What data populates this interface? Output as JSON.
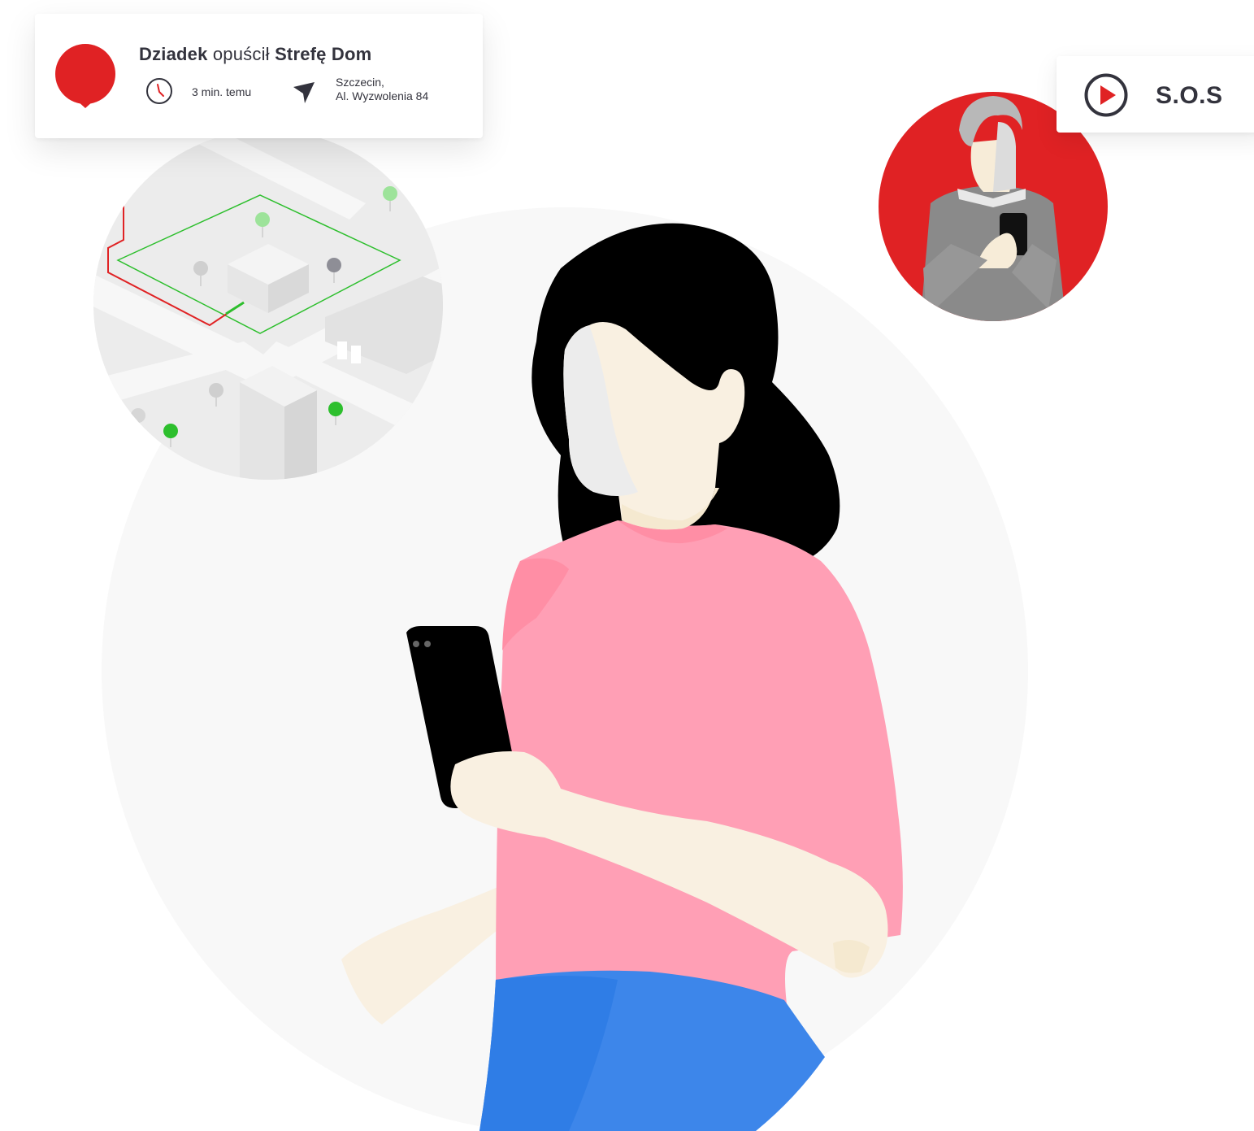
{
  "notification": {
    "subject": "Dziadek",
    "action": "opuścił",
    "zone": "Strefę Dom",
    "time_ago": "3 min. temu",
    "address_line1": "Szczecin,",
    "address_line2": "Al. Wyzwolenia 84",
    "pin_icon": "location-pin-icon",
    "time_icon": "clock-icon",
    "location_icon": "navigation-arrow-icon"
  },
  "sos": {
    "label": "S.O.S",
    "icon": "play-icon"
  },
  "colors": {
    "brand_red": "#e02224",
    "text_dark": "#33333d",
    "zone_green": "#2dbf2d",
    "shirt_pink": "#ff9fb5",
    "jeans_blue": "#3d86ea"
  }
}
